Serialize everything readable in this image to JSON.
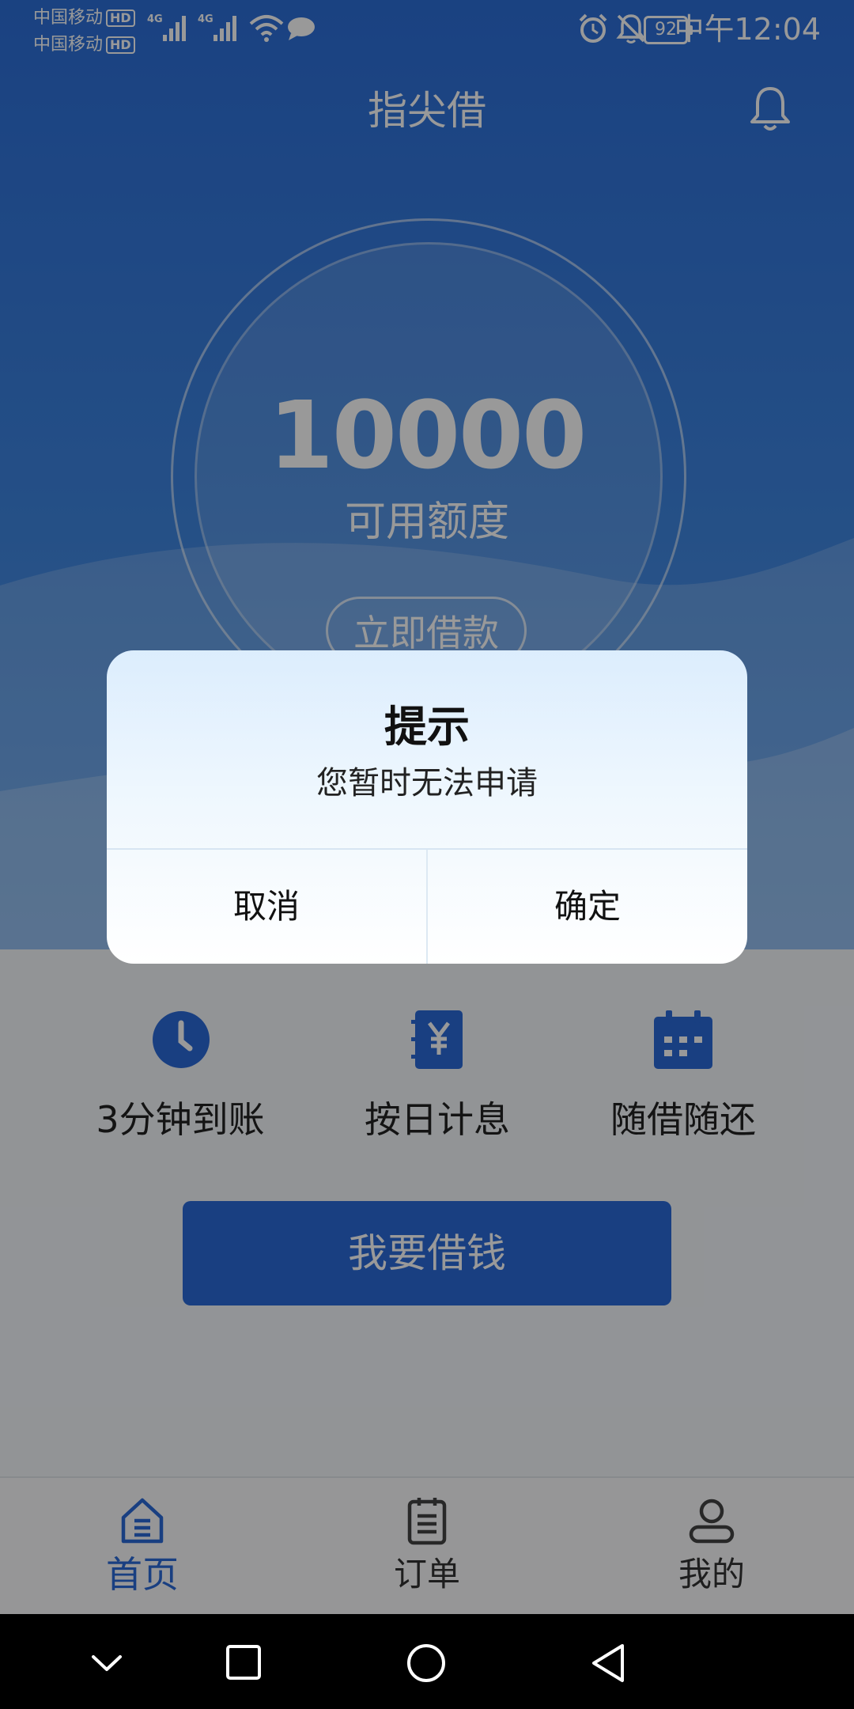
{
  "status_bar": {
    "carrier_1": "中国移动",
    "carrier_2": "中国移动",
    "hd": "HD",
    "network": "4G",
    "battery": "92",
    "time": "中午12:04"
  },
  "header": {
    "title": "指尖借",
    "bell_icon": "bell-icon"
  },
  "credit": {
    "amount": "10000",
    "label": "可用额度",
    "borrow_now": "立即借款"
  },
  "features": [
    {
      "label": "3分钟到账",
      "icon": "clock-icon"
    },
    {
      "label": "按日计息",
      "icon": "yuan-notebook-icon"
    },
    {
      "label": "随借随还",
      "icon": "calendar-icon"
    }
  ],
  "main_button": "我要借钱",
  "tabbar": {
    "items": [
      {
        "label": "首页",
        "icon": "home-icon",
        "active": true
      },
      {
        "label": "订单",
        "icon": "order-icon",
        "active": false
      },
      {
        "label": "我的",
        "icon": "profile-icon",
        "active": false
      }
    ]
  },
  "dialog": {
    "title": "提示",
    "message": "您暂时无法申请",
    "cancel": "取消",
    "confirm": "确定"
  },
  "colors": {
    "primary": "#2a69d8",
    "hero_top": "#2c6ed8",
    "hero_bottom": "#5a9de8"
  }
}
